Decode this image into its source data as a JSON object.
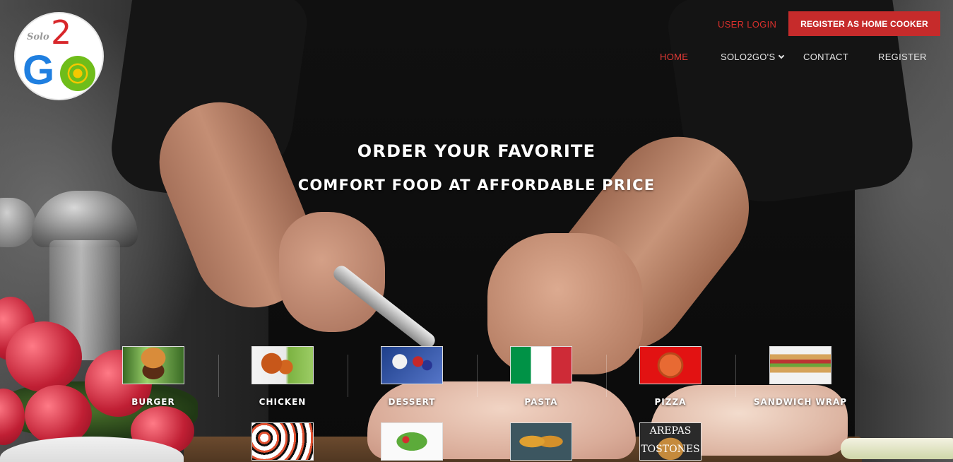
{
  "brand": {
    "logo_solo": "Solo",
    "logo_two": "2",
    "logo_g": "G",
    "logo_colors": {
      "two": "#d8272b",
      "g": "#1f7fe0",
      "o_ring": "#6fbd1a",
      "o_center": "#f5c800"
    }
  },
  "header": {
    "user_login": "USER LOGIN",
    "register_cooker": "REGISTER AS HOME COOKER",
    "accent_color": "#c62b2b"
  },
  "nav": {
    "items": [
      {
        "label": "HOME",
        "active": true
      },
      {
        "label": "SOLO2GO'S",
        "has_dropdown": true
      },
      {
        "label": "CONTACT"
      },
      {
        "label": "REGISTER"
      }
    ]
  },
  "hero": {
    "line1": "ORDER YOUR FAVORITE",
    "line2": "COMFORT FOOD AT AFFORDABLE PRICE"
  },
  "categories": [
    {
      "label": "BURGER",
      "icon": "burger-image"
    },
    {
      "label": "CHICKEN",
      "icon": "chicken-image"
    },
    {
      "label": "DESSERT",
      "icon": "dessert-image"
    },
    {
      "label": "PASTA",
      "icon": "italian-flag-image"
    },
    {
      "label": "PIZZA",
      "icon": "pizza-image"
    },
    {
      "label": "SANDWICH WRAP",
      "icon": "sandwich-image"
    },
    {
      "label": "",
      "icon": "sushi-image"
    },
    {
      "label": "",
      "icon": "salad-image"
    },
    {
      "label": "",
      "icon": "tacos-image"
    },
    {
      "label": "",
      "icon": "arepas-image",
      "image_text": [
        "AREPAS",
        "TOSTONES"
      ]
    }
  ]
}
